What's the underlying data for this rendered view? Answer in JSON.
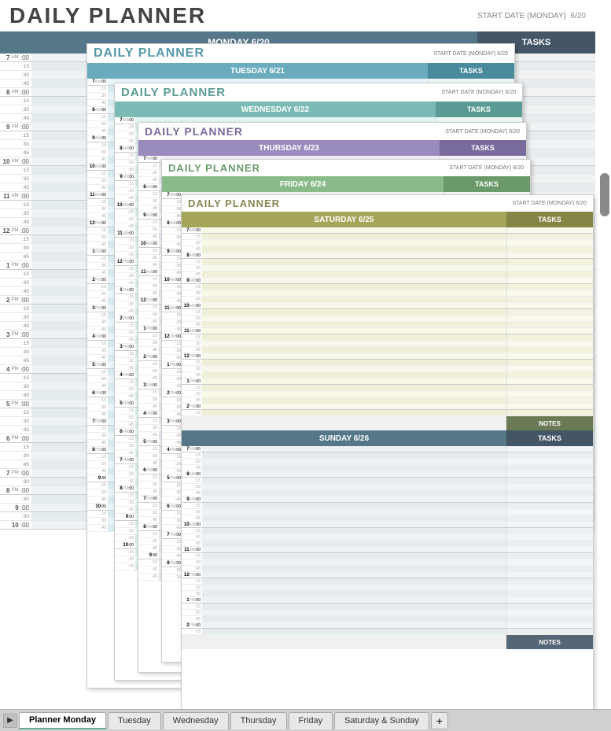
{
  "app": {
    "title": "DAILY PLANNER",
    "start_date_label": "START DATE (MONDAY)",
    "start_date": "6/20"
  },
  "tabs": [
    {
      "label": "Planner Monday",
      "active": true
    },
    {
      "label": "Tuesday",
      "active": false
    },
    {
      "label": "Wednesday",
      "active": false
    },
    {
      "label": "Thursday",
      "active": false
    },
    {
      "label": "Friday",
      "active": false
    },
    {
      "label": "Saturday & Sunday",
      "active": false
    }
  ],
  "days": {
    "monday": {
      "label": "MONDAY 6/20",
      "tasks_label": "TASKS",
      "color": "#557788",
      "tasks_color": "#445566"
    },
    "tuesday": {
      "label": "TUESDAY 6/21",
      "tasks_label": "TASKS",
      "color": "#6aacbd",
      "tasks_color": "#4a8a9d"
    },
    "wednesday": {
      "label": "WEDNESDAY 6/22",
      "tasks_label": "TASKS",
      "color": "#7abcb5",
      "tasks_color": "#5a9c95"
    },
    "thursday": {
      "label": "THURSDAY 6/23",
      "tasks_label": "TASKS",
      "color": "#9a8bbd",
      "tasks_color": "#7a6b9d"
    },
    "friday": {
      "label": "FRIDAY 6/24",
      "tasks_label": "TASKS",
      "color": "#8aba8a",
      "tasks_color": "#6a9a6a"
    },
    "saturday": {
      "label": "SATURDAY 6/25",
      "tasks_label": "TASKS",
      "color": "#a5a55a",
      "tasks_color": "#858545"
    },
    "sunday": {
      "label": "SUNDAY 6/26",
      "tasks_label": "TASKS",
      "color": "#557788",
      "tasks_color": "#445566"
    }
  },
  "time_slots": [
    {
      "hour": "7",
      "ampm": "AM",
      "minutes": [
        ":00",
        ":15",
        ":30",
        ":45"
      ]
    },
    {
      "hour": "8",
      "ampm": "AM",
      "minutes": [
        ":00",
        ":15",
        ":30",
        ":45"
      ]
    },
    {
      "hour": "9",
      "ampm": "AM",
      "minutes": [
        ":00",
        ":15",
        ":30",
        ":45"
      ]
    },
    {
      "hour": "10",
      "ampm": "AM",
      "minutes": [
        ":00",
        ":15",
        ":30",
        ":45"
      ]
    },
    {
      "hour": "11",
      "ampm": "AM",
      "minutes": [
        ":00",
        ":15",
        ":30",
        ":45"
      ]
    },
    {
      "hour": "12",
      "ampm": "PM",
      "minutes": [
        ":00",
        ":15",
        ":30",
        ":45"
      ]
    },
    {
      "hour": "1",
      "ampm": "PM",
      "minutes": [
        ":00",
        ":15",
        ":30",
        ":45"
      ]
    },
    {
      "hour": "2",
      "ampm": "PM",
      "minutes": [
        ":00",
        ":15",
        ":30",
        ":45"
      ]
    },
    {
      "hour": "3",
      "ampm": "PM",
      "minutes": [
        ":00",
        ":15",
        ":30",
        ":45"
      ]
    },
    {
      "hour": "4",
      "ampm": "PM",
      "minutes": [
        ":00",
        ":15",
        ":30",
        ":45"
      ]
    },
    {
      "hour": "5",
      "ampm": "PM",
      "minutes": [
        ":00",
        ":15",
        ":30",
        ":45"
      ]
    },
    {
      "hour": "6",
      "ampm": "PM",
      "minutes": [
        ":00",
        ":15",
        ":30",
        ":45"
      ]
    },
    {
      "hour": "7",
      "ampm": "PM",
      "minutes": [
        ":00",
        ":30"
      ]
    },
    {
      "hour": "8",
      "ampm": "PM",
      "minutes": [
        ":00",
        ":30"
      ]
    },
    {
      "hour": "9",
      "ampm": "",
      "minutes": [
        ":00",
        ":30"
      ]
    },
    {
      "hour": "10",
      "ampm": "",
      "minutes": [
        ":00"
      ]
    }
  ],
  "notes_label": "NOTES"
}
